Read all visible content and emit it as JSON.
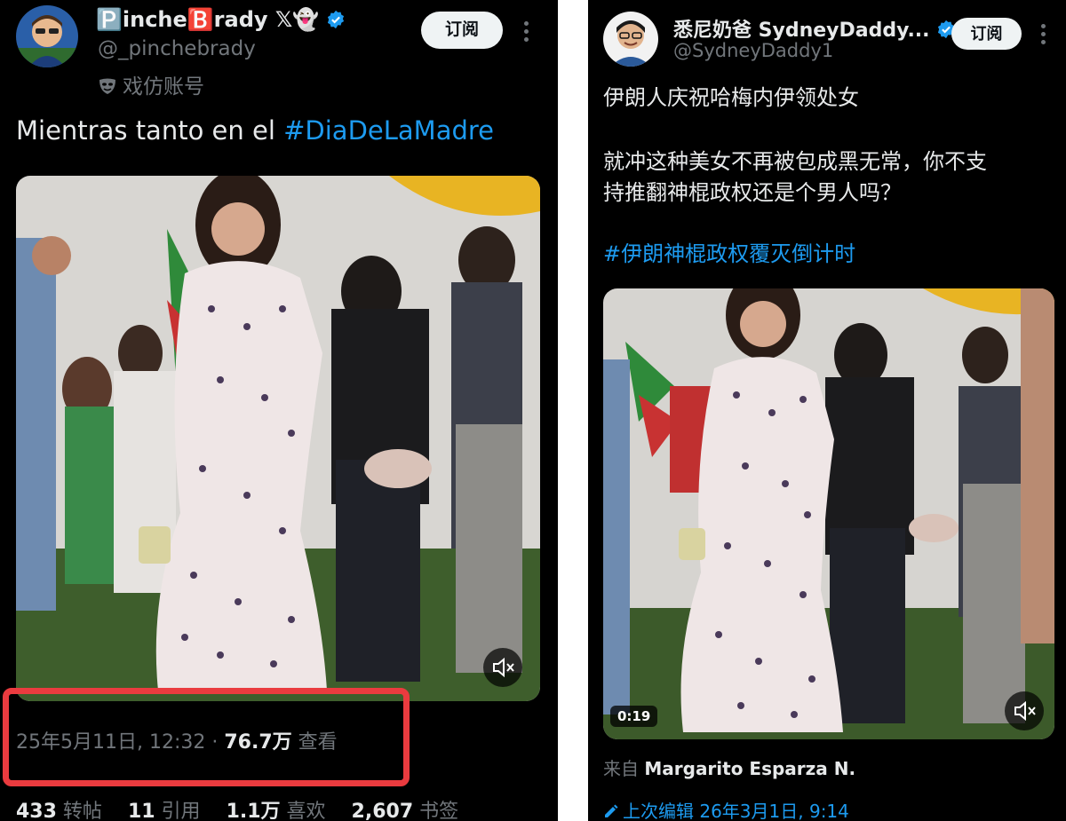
{
  "left": {
    "author": {
      "display_name": "🅿️inche🅱️rady 𝕏👻",
      "handle": "@_pinchebrady",
      "parody_label": "戏仿账号",
      "parody_icon": "mask-icon",
      "verified": true
    },
    "subscribe_label": "订阅",
    "text_before": "Mientras tanto en el ",
    "hashtag": "#DiaDeLaMadre",
    "timestamp": "25年5月11日, 12:32 · ",
    "views_count": "76.7万",
    "views_label": " 查看",
    "stats": [
      {
        "count": "433",
        "label": " 转帖"
      },
      {
        "count": "11",
        "label": " 引用"
      },
      {
        "count": "1.1万",
        "label": " 喜欢"
      },
      {
        "count": "2,607",
        "label": " 书签"
      }
    ]
  },
  "right": {
    "author": {
      "display_name": "悉尼奶爸 SydneyDaddy...",
      "handle": "@SydneyDaddy1",
      "verified": true
    },
    "subscribe_label": "订阅",
    "line1": "伊朗人庆祝哈梅内伊领处女",
    "line2": "就冲这种美女不再被包成黑无常，你不支",
    "line3": "持推翻神棍政权还是个男人吗？",
    "hashtag": "#伊朗神棍政权覆灭倒计时",
    "video_duration": "0:19",
    "source_prefix": "来自 ",
    "source_name": "Margarito Esparza N.",
    "edited_label": "上次编辑 26年3月1日, 9:14"
  },
  "colors": {
    "accent": "#1d9bf0",
    "highlight": "#ea3b3f",
    "background": "#000000"
  }
}
